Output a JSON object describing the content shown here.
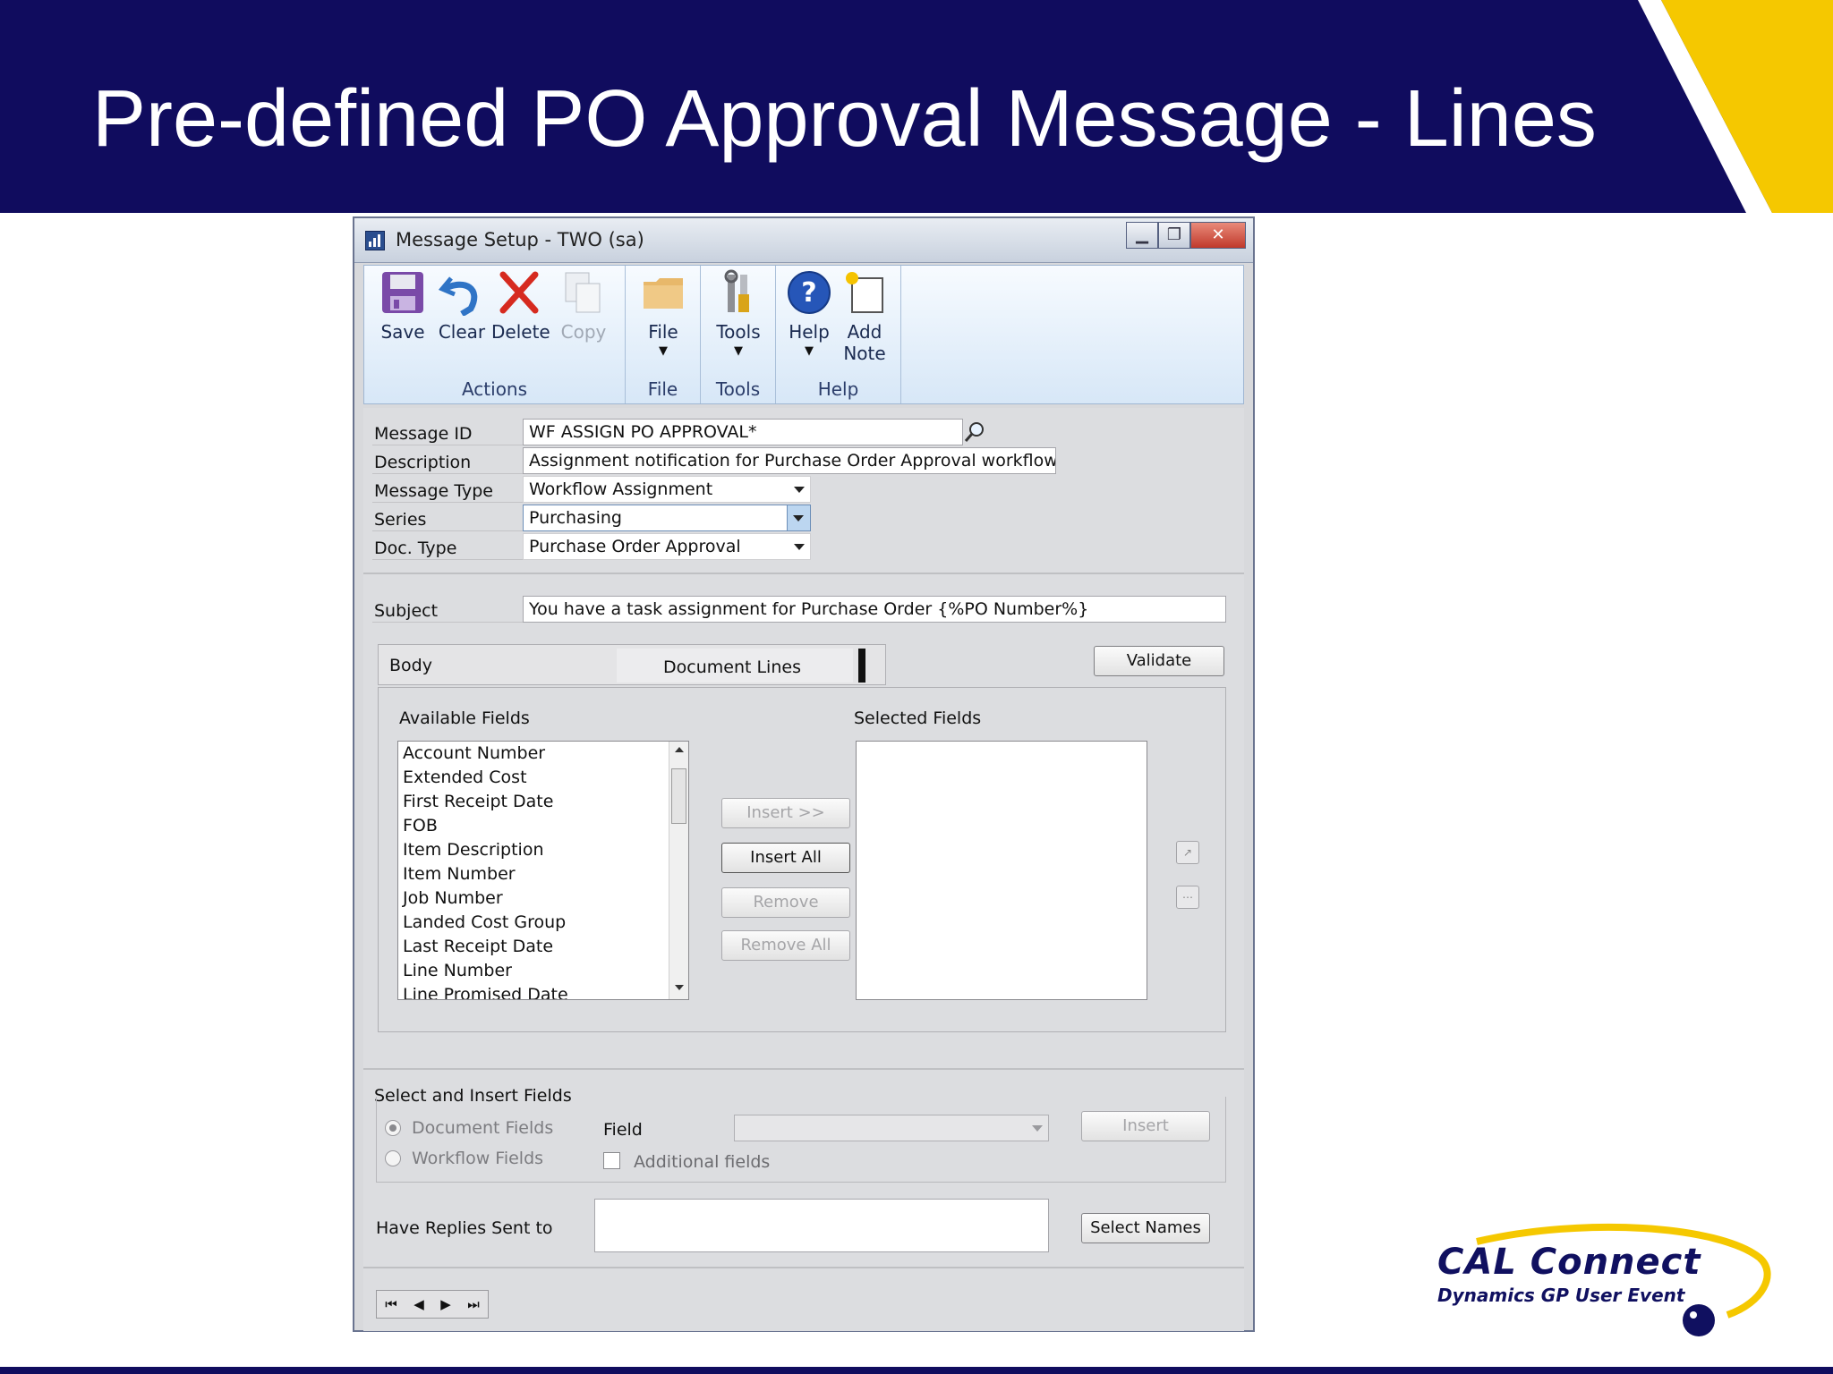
{
  "slide": {
    "title": "Pre-defined PO Approval Message - Lines",
    "colors": {
      "banner": "#100c5e",
      "accent": "#f5c800"
    }
  },
  "window": {
    "title": "Message Setup  -  TWO (sa)",
    "controls": {
      "minimize": "▁",
      "maximize": "❐",
      "close": "✕"
    }
  },
  "ribbon": {
    "actions": {
      "group_label": "Actions",
      "save": "Save",
      "clear": "Clear",
      "delete": "Delete",
      "copy": "Copy"
    },
    "file": {
      "group_label": "File",
      "button": "File"
    },
    "tools": {
      "group_label": "Tools",
      "button": "Tools"
    },
    "help": {
      "group_label": "Help",
      "button": "Help",
      "add_note_1": "Add",
      "add_note_2": "Note"
    }
  },
  "form": {
    "message_id_label": "Message ID",
    "message_id": "WF ASSIGN PO APPROVAL*",
    "description_label": "Description",
    "description": "Assignment notification for Purchase Order Approval workflows",
    "message_type_label": "Message Type",
    "message_type": "Workflow Assignment",
    "series_label": "Series",
    "series": "Purchasing",
    "doc_type_label": "Doc. Type",
    "doc_type": "Purchase Order Approval",
    "subject_label": "Subject",
    "subject": "You have a task assignment for Purchase Order {%PO Number%}"
  },
  "tabs": {
    "body": "Body",
    "document_lines": "Document Lines",
    "validate": "Validate"
  },
  "fields": {
    "available_label": "Available Fields",
    "selected_label": "Selected Fields",
    "available": [
      "Account Number",
      "Extended Cost",
      "First Receipt Date",
      "FOB",
      "Item Description",
      "Item Number",
      "Job Number",
      "Landed Cost Group",
      "Last Receipt Date",
      "Line Number",
      "Line Promised Date"
    ],
    "insert": "Insert >>",
    "insert_all": "Insert All",
    "remove": "Remove",
    "remove_all": "Remove All"
  },
  "select_insert": {
    "group_label": "Select and Insert Fields",
    "document_fields": "Document Fields",
    "workflow_fields": "Workflow Fields",
    "field_label": "Field",
    "field_value": "",
    "additional_fields": "Additional fields",
    "insert": "Insert"
  },
  "replies": {
    "label": "Have Replies Sent to",
    "value": "",
    "select_names": "Select Names"
  },
  "nav": {
    "first": "⏮",
    "prev": "◀",
    "next": "▶",
    "last": "⏭"
  },
  "logo": {
    "line1": "CAL Connect",
    "line2": "Dynamics GP User Event"
  }
}
